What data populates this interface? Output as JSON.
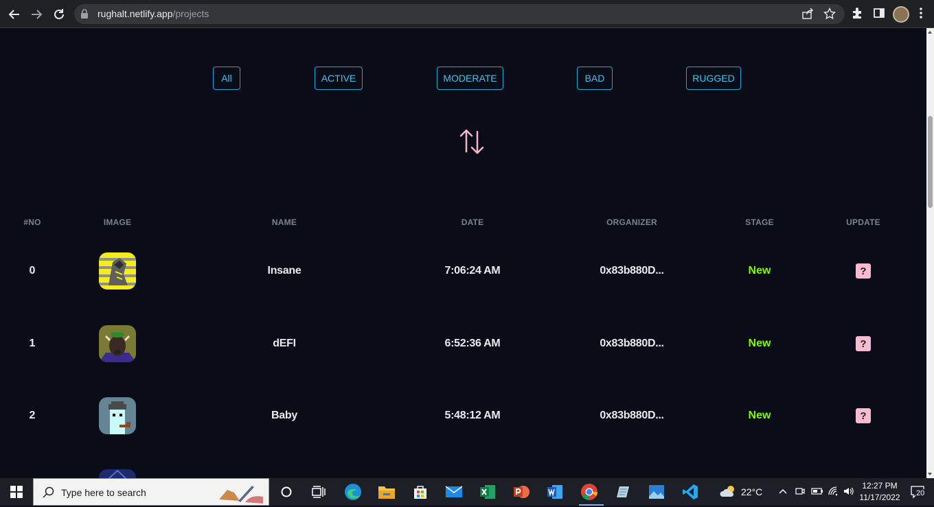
{
  "browser": {
    "url_host": "rughalt.netlify.app",
    "url_path": "/projects"
  },
  "filters": [
    {
      "label": "All"
    },
    {
      "label": "ACTIVE"
    },
    {
      "label": "MODERATE"
    },
    {
      "label": "BAD"
    },
    {
      "label": "RUGGED"
    }
  ],
  "table": {
    "headers": [
      "#NO",
      "IMAGE",
      "NAME",
      "DATE",
      "ORGANIZER",
      "STAGE",
      "UPDATE"
    ],
    "rows": [
      {
        "no": "0",
        "image": "yellow-bull-nft",
        "name": "Insane",
        "date": "7:06:24 AM",
        "organizer": "0x83b880D...",
        "stage": "New",
        "update": "?"
      },
      {
        "no": "1",
        "image": "bull-green-hat-nft",
        "name": "dEFI",
        "date": "6:52:36 AM",
        "organizer": "0x83b880D...",
        "stage": "New",
        "update": "?"
      },
      {
        "no": "2",
        "image": "cryptopunk-pipe-nft",
        "name": "Baby",
        "date": "5:48:12 AM",
        "organizer": "0x83b880D...",
        "stage": "New",
        "update": "?"
      }
    ]
  },
  "taskbar": {
    "search_placeholder": "Type here to search",
    "weather": "22°C",
    "time": "12:27 PM",
    "date": "11/17/2022",
    "notifications": "20"
  },
  "colors": {
    "page_bg": "#0a0d18",
    "accent_cyan": "#3ec3f2",
    "stage_green": "#7cfc00",
    "update_pink": "#f8bbcf",
    "sort_pink": "#f4b6c8"
  }
}
